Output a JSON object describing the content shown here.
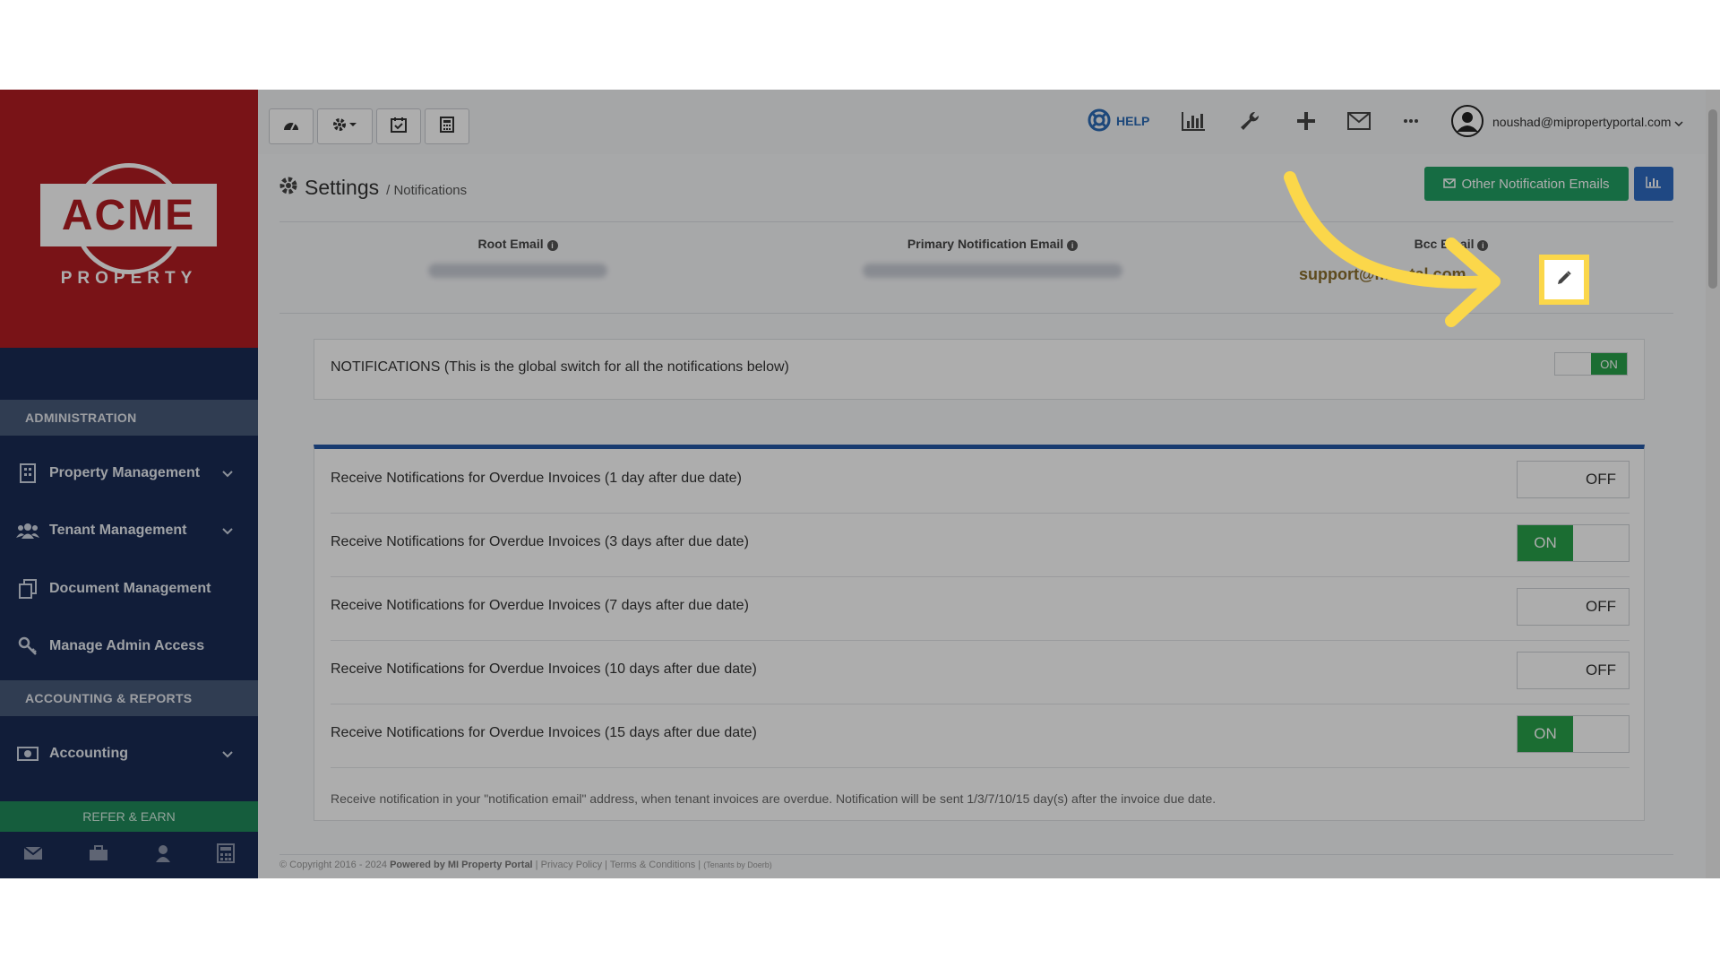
{
  "brand": {
    "logo_text": "ACME",
    "logo_sub": "PROPERTY",
    "primary_color": "#b31d23"
  },
  "sidebar": {
    "sections": [
      {
        "label": "ADMINISTRATION"
      },
      {
        "label": "ACCOUNTING & REPORTS"
      }
    ],
    "items": [
      {
        "label": "Property Management",
        "icon": "building-icon",
        "expandable": true
      },
      {
        "label": "Tenant Management",
        "icon": "users-icon",
        "expandable": true
      },
      {
        "label": "Document Management",
        "icon": "documents-icon",
        "expandable": false
      },
      {
        "label": "Manage Admin Access",
        "icon": "key-icon",
        "expandable": false
      },
      {
        "label": "Accounting",
        "icon": "money-icon",
        "expandable": true
      }
    ],
    "refer_label": "REFER & EARN",
    "bottom_icons": [
      "mail-icon",
      "briefcase-icon",
      "user-icon",
      "calculator-icon"
    ]
  },
  "topbar": {
    "left_buttons": [
      "dashboard-icon",
      "gear-dropdown-icon",
      "calendar-check-icon",
      "calculator-icon"
    ],
    "help_label": "HELP",
    "right_icons": [
      "bar-chart-icon",
      "wrench-icon",
      "plus-icon",
      "envelope-icon",
      "more-icon"
    ],
    "user_email": "noushad@mipropertyportal.com"
  },
  "page": {
    "title": "Settings",
    "breadcrumb": "/ Notifications",
    "other_emails_button": "Other Notification Emails"
  },
  "emails": {
    "root_label": "Root Email",
    "primary_label": "Primary Notification Email",
    "bcc_label": "Bcc Email",
    "bcc_value": "support@mi…tal.com"
  },
  "global_switch": {
    "label": "NOTIFICATIONS (This is the global switch for all the notifications below)",
    "state": "ON"
  },
  "notifications": [
    {
      "label": "Receive Notifications for Overdue Invoices (1 day after due date)",
      "state": "OFF"
    },
    {
      "label": "Receive Notifications for Overdue Invoices (3 days after due date)",
      "state": "ON"
    },
    {
      "label": "Receive Notifications for Overdue Invoices (7 days after due date)",
      "state": "OFF"
    },
    {
      "label": "Receive Notifications for Overdue Invoices (10 days after due date)",
      "state": "OFF"
    },
    {
      "label": "Receive Notifications for Overdue Invoices (15 days after due date)",
      "state": "ON"
    }
  ],
  "note": "Receive notification in your \"notification email\" address, when tenant invoices are overdue. Notification will be sent 1/3/7/10/15 day(s) after the invoice due date.",
  "footer": {
    "copyright": "© Copyright 2016 - 2024",
    "powered": "Powered by MI Property Portal",
    "privacy": "Privacy Policy",
    "terms": "Terms & Conditions",
    "small": "(Tenants by Doerb)"
  },
  "colors": {
    "on_green": "#28a14a",
    "button_green": "#21a064",
    "button_blue": "#2f6bc1",
    "highlight_yellow": "#fbd74a"
  }
}
